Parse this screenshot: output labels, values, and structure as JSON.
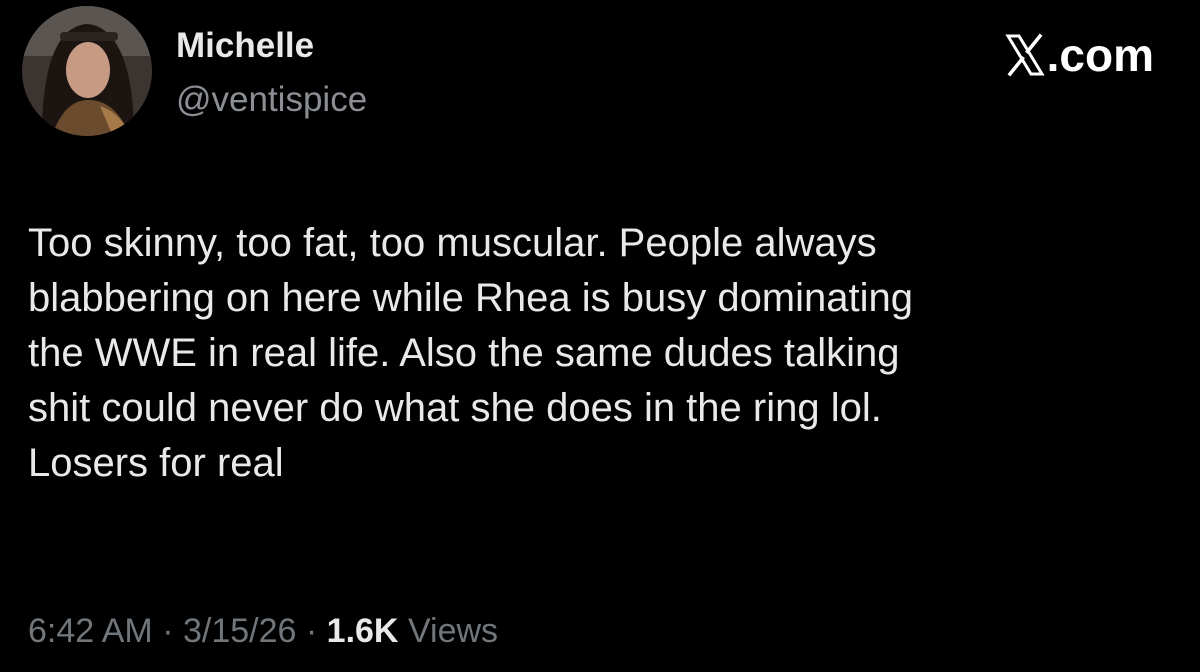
{
  "author": {
    "display_name": "Michelle",
    "handle": "@ventispice",
    "avatar_icon": "profile-photo-avatar"
  },
  "brand": {
    "logo_icon": "x-logo-icon",
    "suffix": ".com"
  },
  "tweet": {
    "lines": [
      "Too skinny, too fat, too muscular. People always",
      "blabbering on here while Rhea is busy dominating",
      "the WWE in real life. Also the same dudes talking",
      "shit could never do what she does in the ring lol.",
      "Losers for real"
    ]
  },
  "meta": {
    "time": "6:42 AM",
    "separator": "·",
    "date": "3/15/26",
    "views_count": "1.6K",
    "views_label": "Views"
  },
  "colors": {
    "background": "#000000",
    "primary_text": "#e7e9ea",
    "secondary_text": "#71767b"
  }
}
